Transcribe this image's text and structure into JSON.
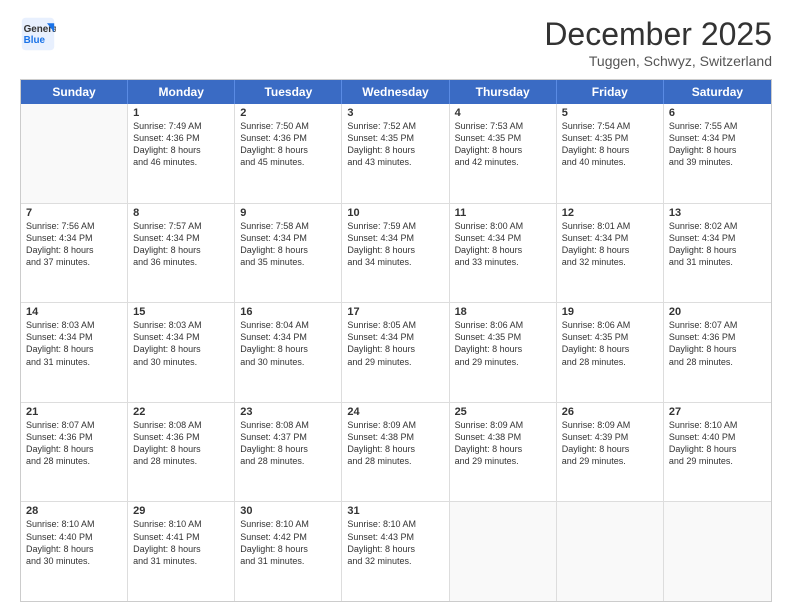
{
  "logo": {
    "line1": "General",
    "line2": "Blue"
  },
  "title": "December 2025",
  "location": "Tuggen, Schwyz, Switzerland",
  "weekdays": [
    "Sunday",
    "Monday",
    "Tuesday",
    "Wednesday",
    "Thursday",
    "Friday",
    "Saturday"
  ],
  "weeks": [
    [
      {
        "day": "",
        "info": ""
      },
      {
        "day": "1",
        "info": "Sunrise: 7:49 AM\nSunset: 4:36 PM\nDaylight: 8 hours\nand 46 minutes."
      },
      {
        "day": "2",
        "info": "Sunrise: 7:50 AM\nSunset: 4:36 PM\nDaylight: 8 hours\nand 45 minutes."
      },
      {
        "day": "3",
        "info": "Sunrise: 7:52 AM\nSunset: 4:35 PM\nDaylight: 8 hours\nand 43 minutes."
      },
      {
        "day": "4",
        "info": "Sunrise: 7:53 AM\nSunset: 4:35 PM\nDaylight: 8 hours\nand 42 minutes."
      },
      {
        "day": "5",
        "info": "Sunrise: 7:54 AM\nSunset: 4:35 PM\nDaylight: 8 hours\nand 40 minutes."
      },
      {
        "day": "6",
        "info": "Sunrise: 7:55 AM\nSunset: 4:34 PM\nDaylight: 8 hours\nand 39 minutes."
      }
    ],
    [
      {
        "day": "7",
        "info": "Sunrise: 7:56 AM\nSunset: 4:34 PM\nDaylight: 8 hours\nand 37 minutes."
      },
      {
        "day": "8",
        "info": "Sunrise: 7:57 AM\nSunset: 4:34 PM\nDaylight: 8 hours\nand 36 minutes."
      },
      {
        "day": "9",
        "info": "Sunrise: 7:58 AM\nSunset: 4:34 PM\nDaylight: 8 hours\nand 35 minutes."
      },
      {
        "day": "10",
        "info": "Sunrise: 7:59 AM\nSunset: 4:34 PM\nDaylight: 8 hours\nand 34 minutes."
      },
      {
        "day": "11",
        "info": "Sunrise: 8:00 AM\nSunset: 4:34 PM\nDaylight: 8 hours\nand 33 minutes."
      },
      {
        "day": "12",
        "info": "Sunrise: 8:01 AM\nSunset: 4:34 PM\nDaylight: 8 hours\nand 32 minutes."
      },
      {
        "day": "13",
        "info": "Sunrise: 8:02 AM\nSunset: 4:34 PM\nDaylight: 8 hours\nand 31 minutes."
      }
    ],
    [
      {
        "day": "14",
        "info": "Sunrise: 8:03 AM\nSunset: 4:34 PM\nDaylight: 8 hours\nand 31 minutes."
      },
      {
        "day": "15",
        "info": "Sunrise: 8:03 AM\nSunset: 4:34 PM\nDaylight: 8 hours\nand 30 minutes."
      },
      {
        "day": "16",
        "info": "Sunrise: 8:04 AM\nSunset: 4:34 PM\nDaylight: 8 hours\nand 30 minutes."
      },
      {
        "day": "17",
        "info": "Sunrise: 8:05 AM\nSunset: 4:34 PM\nDaylight: 8 hours\nand 29 minutes."
      },
      {
        "day": "18",
        "info": "Sunrise: 8:06 AM\nSunset: 4:35 PM\nDaylight: 8 hours\nand 29 minutes."
      },
      {
        "day": "19",
        "info": "Sunrise: 8:06 AM\nSunset: 4:35 PM\nDaylight: 8 hours\nand 28 minutes."
      },
      {
        "day": "20",
        "info": "Sunrise: 8:07 AM\nSunset: 4:36 PM\nDaylight: 8 hours\nand 28 minutes."
      }
    ],
    [
      {
        "day": "21",
        "info": "Sunrise: 8:07 AM\nSunset: 4:36 PM\nDaylight: 8 hours\nand 28 minutes."
      },
      {
        "day": "22",
        "info": "Sunrise: 8:08 AM\nSunset: 4:36 PM\nDaylight: 8 hours\nand 28 minutes."
      },
      {
        "day": "23",
        "info": "Sunrise: 8:08 AM\nSunset: 4:37 PM\nDaylight: 8 hours\nand 28 minutes."
      },
      {
        "day": "24",
        "info": "Sunrise: 8:09 AM\nSunset: 4:38 PM\nDaylight: 8 hours\nand 28 minutes."
      },
      {
        "day": "25",
        "info": "Sunrise: 8:09 AM\nSunset: 4:38 PM\nDaylight: 8 hours\nand 29 minutes."
      },
      {
        "day": "26",
        "info": "Sunrise: 8:09 AM\nSunset: 4:39 PM\nDaylight: 8 hours\nand 29 minutes."
      },
      {
        "day": "27",
        "info": "Sunrise: 8:10 AM\nSunset: 4:40 PM\nDaylight: 8 hours\nand 29 minutes."
      }
    ],
    [
      {
        "day": "28",
        "info": "Sunrise: 8:10 AM\nSunset: 4:40 PM\nDaylight: 8 hours\nand 30 minutes."
      },
      {
        "day": "29",
        "info": "Sunrise: 8:10 AM\nSunset: 4:41 PM\nDaylight: 8 hours\nand 31 minutes."
      },
      {
        "day": "30",
        "info": "Sunrise: 8:10 AM\nSunset: 4:42 PM\nDaylight: 8 hours\nand 31 minutes."
      },
      {
        "day": "31",
        "info": "Sunrise: 8:10 AM\nSunset: 4:43 PM\nDaylight: 8 hours\nand 32 minutes."
      },
      {
        "day": "",
        "info": ""
      },
      {
        "day": "",
        "info": ""
      },
      {
        "day": "",
        "info": ""
      }
    ]
  ]
}
